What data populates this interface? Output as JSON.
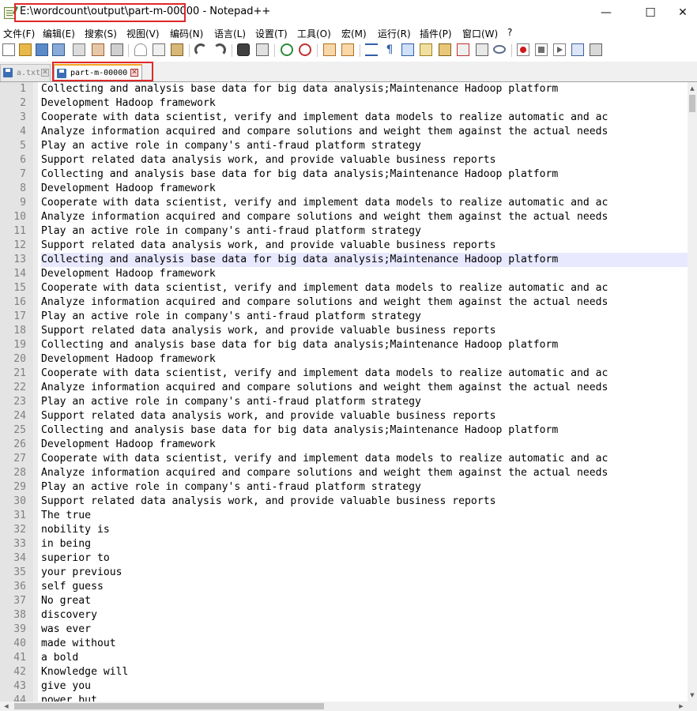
{
  "window": {
    "title_path": "E:\\wordcount\\output\\part-m-00000",
    "title_rest": " - Notepad++",
    "minimize_glyph": "—",
    "maximize_glyph": "☐",
    "close_glyph": "✕"
  },
  "menu": [
    "文件(F)",
    "编辑(E)",
    "搜索(S)",
    "视图(V)",
    "编码(N)",
    "语言(L)",
    "设置(T)",
    "工具(O)",
    "宏(M)",
    "运行(R)",
    "插件(P)",
    "窗口(W)",
    "?"
  ],
  "toolbar_icons": [
    "new-file-icon",
    "open-file-icon",
    "save-icon",
    "save-all-icon",
    "close-icon",
    "close-all-icon",
    "print-icon",
    "cut-icon",
    "copy-icon",
    "paste-icon",
    "undo-icon",
    "redo-icon",
    "find-icon",
    "replace-icon",
    "zoom-in-icon",
    "zoom-out-icon",
    "sync-vertical-icon",
    "sync-horizontal-icon",
    "word-wrap-icon",
    "show-all-chars-icon",
    "indent-guide-icon",
    "doc-map-icon",
    "function-list-icon",
    "folder-workspace-icon",
    "monitoring-icon",
    "record-macro-icon",
    "stop-record-icon",
    "play-macro-icon",
    "run-macro-multiple-icon",
    "save-macro-icon"
  ],
  "tabs": [
    {
      "label": "a.txt",
      "close": "✕",
      "active": false,
      "icon_color": "#3c6eb4"
    },
    {
      "label": "part-m-00000",
      "close": "✕",
      "active": true,
      "icon_color": "#3c6eb4"
    }
  ],
  "editor": {
    "current_line": 13,
    "lines": [
      {
        "n": "1",
        "t": "Collecting and analysis base data for big data analysis;Maintenance Hadoop platform"
      },
      {
        "n": "2",
        "t": "Development Hadoop framework"
      },
      {
        "n": "3",
        "t": "Cooperate with data scientist, verify and implement data models to realize automatic and ac"
      },
      {
        "n": "4",
        "t": "Analyze information acquired and compare solutions and weight them against the actual needs"
      },
      {
        "n": "5",
        "t": "Play an active role in company's anti-fraud platform strategy"
      },
      {
        "n": "6",
        "t": "Support related data analysis work, and provide valuable business reports"
      },
      {
        "n": "7",
        "t": "Collecting and analysis base data for big data analysis;Maintenance Hadoop platform"
      },
      {
        "n": "8",
        "t": "Development Hadoop framework"
      },
      {
        "n": "9",
        "t": "Cooperate with data scientist, verify and implement data models to realize automatic and ac"
      },
      {
        "n": "10",
        "t": "Analyze information acquired and compare solutions and weight them against the actual needs"
      },
      {
        "n": "11",
        "t": "Play an active role in company's anti-fraud platform strategy"
      },
      {
        "n": "12",
        "t": "Support related data analysis work, and provide valuable business reports"
      },
      {
        "n": "13",
        "t": "Collecting and analysis base data for big data analysis;Maintenance Hadoop platform"
      },
      {
        "n": "14",
        "t": "Development Hadoop framework"
      },
      {
        "n": "15",
        "t": "Cooperate with data scientist, verify and implement data models to realize automatic and ac"
      },
      {
        "n": "16",
        "t": "Analyze information acquired and compare solutions and weight them against the actual needs"
      },
      {
        "n": "17",
        "t": "Play an active role in company's anti-fraud platform strategy"
      },
      {
        "n": "18",
        "t": "Support related data analysis work, and provide valuable business reports"
      },
      {
        "n": "19",
        "t": "Collecting and analysis base data for big data analysis;Maintenance Hadoop platform"
      },
      {
        "n": "20",
        "t": "Development Hadoop framework"
      },
      {
        "n": "21",
        "t": "Cooperate with data scientist, verify and implement data models to realize automatic and ac"
      },
      {
        "n": "22",
        "t": "Analyze information acquired and compare solutions and weight them against the actual needs"
      },
      {
        "n": "23",
        "t": "Play an active role in company's anti-fraud platform strategy"
      },
      {
        "n": "24",
        "t": "Support related data analysis work, and provide valuable business reports"
      },
      {
        "n": "25",
        "t": "Collecting and analysis base data for big data analysis;Maintenance Hadoop platform"
      },
      {
        "n": "26",
        "t": "Development Hadoop framework"
      },
      {
        "n": "27",
        "t": "Cooperate with data scientist, verify and implement data models to realize automatic and ac"
      },
      {
        "n": "28",
        "t": "Analyze information acquired and compare solutions and weight them against the actual needs"
      },
      {
        "n": "29",
        "t": "Play an active role in company's anti-fraud platform strategy"
      },
      {
        "n": "30",
        "t": "Support related data analysis work, and provide valuable business reports"
      },
      {
        "n": "31",
        "t": "The true"
      },
      {
        "n": "32",
        "t": "nobility is"
      },
      {
        "n": "33",
        "t": "in being"
      },
      {
        "n": "34",
        "t": "superior to"
      },
      {
        "n": "35",
        "t": "your previous"
      },
      {
        "n": "36",
        "t": "self guess"
      },
      {
        "n": "37",
        "t": "No great"
      },
      {
        "n": "38",
        "t": "discovery"
      },
      {
        "n": "39",
        "t": "was ever"
      },
      {
        "n": "40",
        "t": "made without"
      },
      {
        "n": "41",
        "t": "a bold"
      },
      {
        "n": "42",
        "t": "Knowledge will"
      },
      {
        "n": "43",
        "t": "give you"
      },
      {
        "n": "44",
        "t": "power but"
      }
    ]
  },
  "scrollbars": {
    "up_glyph": "▲",
    "down_glyph": "▼",
    "left_glyph": "◀",
    "right_glyph": "▶"
  }
}
